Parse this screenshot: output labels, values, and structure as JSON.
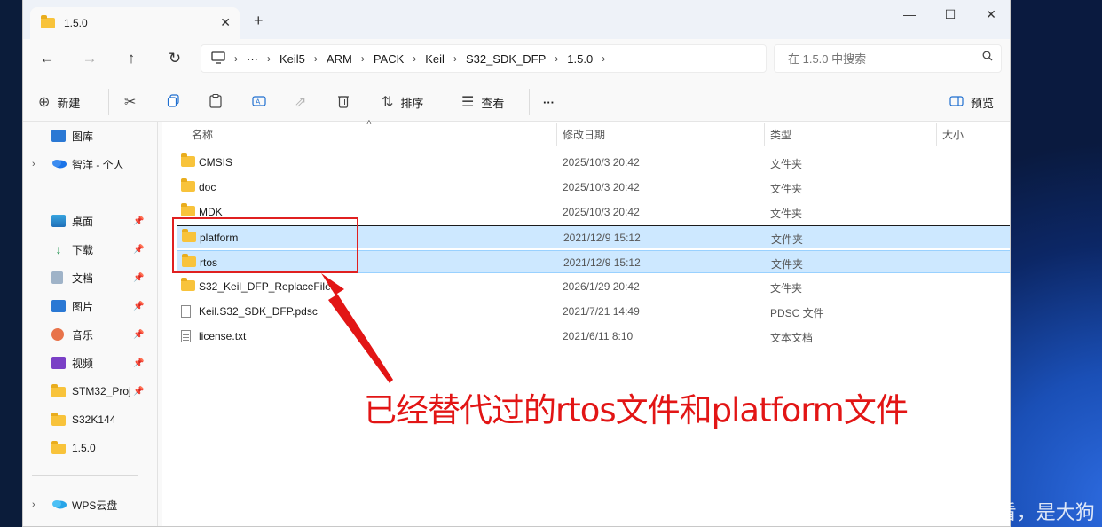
{
  "window": {
    "tab_title": "1.5.0",
    "tab_close": "✕",
    "new_tab": "+",
    "minimize": "—",
    "maximize": "☐",
    "close": "✕"
  },
  "nav": {
    "back": "←",
    "forward": "→",
    "up": "↑",
    "refresh": "↻"
  },
  "breadcrumb": [
    "Keil5",
    "ARM",
    "PACK",
    "Keil",
    "S32_SDK_DFP",
    "1.5.0"
  ],
  "breadcrumb_more": "···",
  "search": {
    "placeholder": "在 1.5.0 中搜索"
  },
  "toolbar": {
    "new_label": "新建",
    "sort_label": "排序",
    "view_label": "查看",
    "more_label": "···",
    "preview_label": "预览"
  },
  "sidebar": {
    "items": [
      {
        "label": "图库",
        "icon": "gallery-icon"
      },
      {
        "label": "智洋 - 个人",
        "icon": "onedrive-icon"
      },
      {
        "label": "桌面",
        "icon": "desktop-icon"
      },
      {
        "label": "下载",
        "icon": "download-icon"
      },
      {
        "label": "文档",
        "icon": "documents-icon"
      },
      {
        "label": "图片",
        "icon": "pictures-icon"
      },
      {
        "label": "音乐",
        "icon": "music-icon"
      },
      {
        "label": "视频",
        "icon": "videos-icon"
      },
      {
        "label": "STM32_Proj",
        "icon": "folder-icon"
      },
      {
        "label": "S32K144",
        "icon": "folder-icon"
      },
      {
        "label": "1.5.0",
        "icon": "folder-icon"
      },
      {
        "label": "WPS云盘",
        "icon": "cloud-icon"
      }
    ]
  },
  "columns": {
    "name": "名称",
    "date": "修改日期",
    "type": "类型",
    "size": "大小"
  },
  "files": [
    {
      "name": "CMSIS",
      "date": "2025/10/3 20:42",
      "type": "文件夹",
      "kind": "folder"
    },
    {
      "name": "doc",
      "date": "2025/10/3 20:42",
      "type": "文件夹",
      "kind": "folder"
    },
    {
      "name": "MDK",
      "date": "2025/10/3 20:42",
      "type": "文件夹",
      "kind": "folder"
    },
    {
      "name": "platform",
      "date": "2021/12/9 15:12",
      "type": "文件夹",
      "kind": "folder",
      "selected": true
    },
    {
      "name": "rtos",
      "date": "2021/12/9 15:12",
      "type": "文件夹",
      "kind": "folder",
      "selected": true
    },
    {
      "name": "S32_Keil_DFP_ReplaceFiles",
      "date": "2026/1/29 20:42",
      "type": "文件夹",
      "kind": "folder"
    },
    {
      "name": "Keil.S32_SDK_DFP.pdsc",
      "date": "2021/7/21 14:49",
      "type": "PDSC 文件",
      "kind": "file"
    },
    {
      "name": "license.txt",
      "date": "2021/6/11 8:10",
      "type": "文本文档",
      "kind": "text"
    }
  ],
  "annotation": "已经替代过的rtos文件和platform文件",
  "watermark": "CSDN @看，是大狗",
  "colors": {
    "annotation_red": "#e21515",
    "selection": "#cde8ff",
    "folder": "#f8c33b"
  }
}
